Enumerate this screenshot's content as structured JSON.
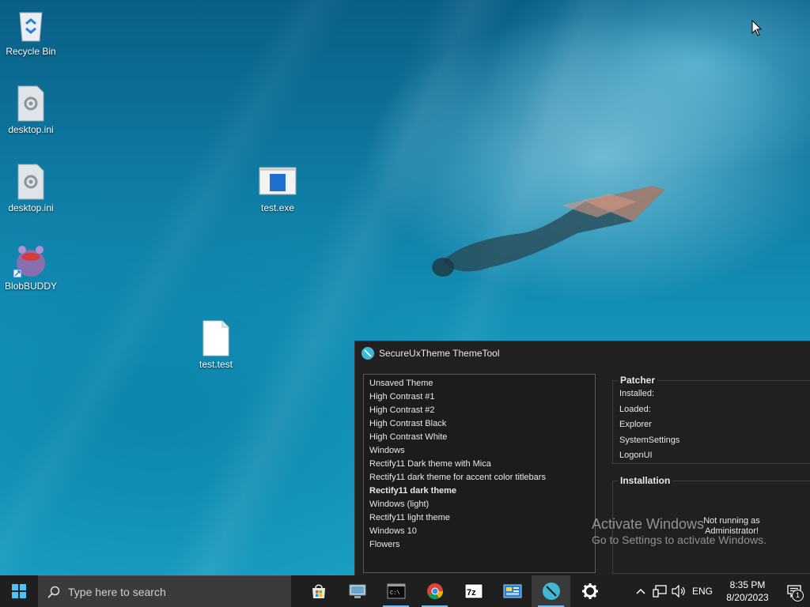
{
  "desktop": {
    "icons": [
      {
        "label": "Recycle Bin",
        "icon": "recycle-bin-icon"
      },
      {
        "label": "desktop.ini",
        "icon": "settings-file-icon"
      },
      {
        "label": "desktop.ini",
        "icon": "settings-file-icon"
      },
      {
        "label": "BlobBUDDY",
        "icon": "blobbuddy-icon"
      },
      {
        "label": "test.exe",
        "icon": "exe-file-icon"
      },
      {
        "label": "test.test",
        "icon": "blank-file-icon"
      }
    ]
  },
  "window": {
    "title": "SecureUxTheme ThemeTool",
    "themes": [
      "Unsaved Theme",
      "High Contrast #1",
      "High Contrast #2",
      "High Contrast Black",
      "High Contrast White",
      "Windows",
      "Rectify11 Dark theme with Mica",
      "Rectify11 dark theme for accent color titlebars",
      "Rectify11 dark theme",
      "Windows (light)",
      "Rectify11 light theme",
      "Windows 10",
      "Flowers"
    ],
    "selected_theme": "Rectify11 dark theme",
    "patcher": {
      "title": "Patcher",
      "installed_label": "Installed:",
      "loaded_label": "Loaded:",
      "explorer_label": "Explorer",
      "systemsettings_label": "SystemSettings",
      "logonui_label": "LogonUI"
    },
    "installation": {
      "title": "Installation",
      "status_line1": "Not running as",
      "status_line2": "Administrator!"
    }
  },
  "watermark": {
    "line1": "Activate Windows",
    "line2": "Go to Settings to activate Windows."
  },
  "taskbar": {
    "search_placeholder": "Type here to search",
    "apps": [
      "microsoft-store-icon",
      "computer-management-icon",
      "command-prompt-icon",
      "chrome-icon",
      "7zip-icon",
      "control-panel-icon",
      "securexutheme-icon",
      "settings-gear-icon"
    ],
    "language": "ENG",
    "time": "8:35 PM",
    "date": "8/20/2023",
    "notification_count": "1"
  },
  "colors": {
    "accent": "#3fb8d6",
    "window_bg": "#202020",
    "taskbar_bg": "#1f1f1f"
  }
}
